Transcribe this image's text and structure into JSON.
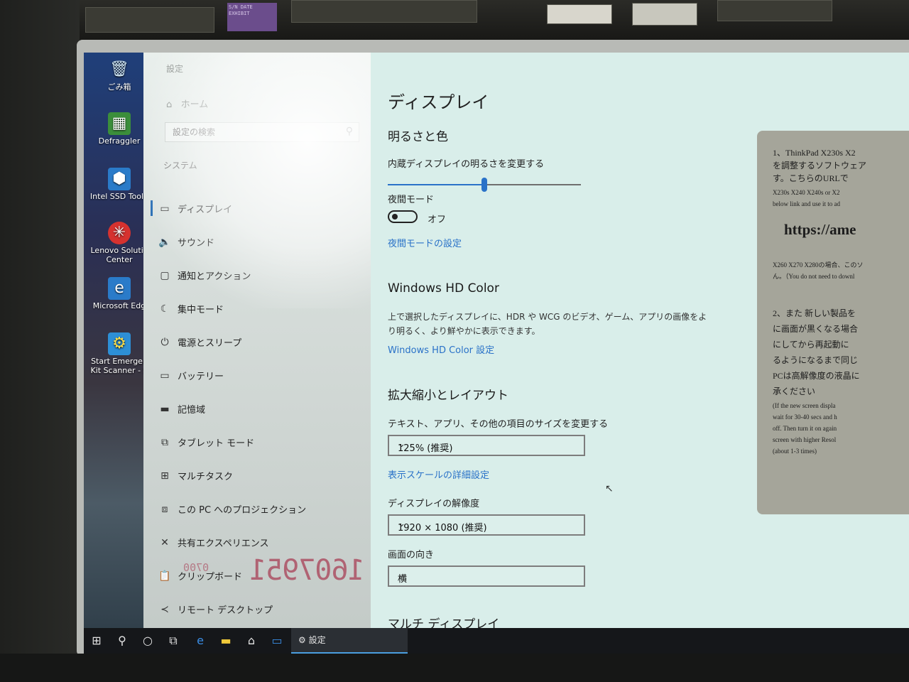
{
  "desktop": {
    "icons": [
      {
        "label": "ごみ箱",
        "icon": "recycle-bin-icon"
      },
      {
        "label": "Defraggler",
        "icon": "defraggler-icon"
      },
      {
        "label": "Intel SSD Toolb",
        "icon": "intel-ssd-icon"
      },
      {
        "label": "Lenovo Solutio",
        "label2": "Center",
        "icon": "lenovo-icon"
      },
      {
        "label": "Microsoft Edg",
        "icon": "edge-icon"
      },
      {
        "label": "Start Emergen",
        "label2": "Kit Scanner - S",
        "icon": "scanner-icon"
      }
    ]
  },
  "sidebar": {
    "app_title": "設定",
    "home": "ホーム",
    "search_placeholder": "設定の検索",
    "section": "システム",
    "items": [
      {
        "label": "ディスプレイ",
        "icon": "monitor-icon"
      },
      {
        "label": "サウンド",
        "icon": "speaker-icon"
      },
      {
        "label": "通知とアクション",
        "icon": "notification-icon"
      },
      {
        "label": "集中モード",
        "icon": "moon-icon"
      },
      {
        "label": "電源とスリープ",
        "icon": "power-icon"
      },
      {
        "label": "バッテリー",
        "icon": "battery-icon"
      },
      {
        "label": "記憶域",
        "icon": "storage-icon"
      },
      {
        "label": "タブレット モード",
        "icon": "tablet-icon"
      },
      {
        "label": "マルチタスク",
        "icon": "multitask-icon"
      },
      {
        "label": "この PC へのプロジェクション",
        "icon": "projection-icon"
      },
      {
        "label": "共有エクスペリエンス",
        "icon": "share-icon"
      },
      {
        "label": "クリップボード",
        "icon": "clipboard-icon"
      },
      {
        "label": "リモート デスクトップ",
        "icon": "remote-icon"
      }
    ]
  },
  "content": {
    "title": "ディスプレイ",
    "brightness": {
      "heading": "明るさと色",
      "label": "内蔵ディスプレイの明るさを変更する",
      "value_percent": 50
    },
    "night_mode": {
      "label": "夜間モード",
      "state": "オフ",
      "settings_link": "夜間モードの設定"
    },
    "hd_color": {
      "heading": "Windows HD Color",
      "description": "上で選択したディスプレイに、HDR や WCG のビデオ、ゲーム、アプリの画像をより明るく、より鮮やかに表示できます。",
      "link": "Windows HD Color 設定"
    },
    "scale_layout": {
      "heading": "拡大縮小とレイアウト",
      "scale_label": "テキスト、アプリ、その他の項目のサイズを変更する",
      "scale_value": "125% (推奨)",
      "advanced_link": "表示スケールの詳細設定",
      "resolution_label": "ディスプレイの解像度",
      "resolution_value": "1920 × 1080 (推奨)",
      "orientation_label": "画面の向き",
      "orientation_value": "横"
    },
    "multi_display_heading": "マルチ ディスプレイ"
  },
  "paper": {
    "lines": [
      "1、ThinkPad X230s X2",
      "を調整するソフトウェア",
      "す。こちらのURLで",
      "X230s X240 X240s or X2",
      "below link and use it to ad",
      "https://ame",
      "X260 X270 X280の場合、このソ",
      "ん。（You do not need to downl",
      "2、また 新しい製品を",
      "に画面が黒くなる場合",
      "にしてから再起動に",
      "るようになるまで同じ",
      "PCは高解像度の液晶に",
      "承ください",
      "(If the new screen displa",
      "wait for 30-40 secs and h",
      "off. Then turn it on again",
      "screen with higher Resol",
      "(about 1-3 times)"
    ]
  },
  "stamp": {
    "main": "1607951",
    "small": "0700"
  },
  "taskbar": {
    "icons": [
      "windows-start-icon",
      "search-icon",
      "cortana-icon",
      "task-view-icon",
      "edge-icon",
      "file-explorer-icon",
      "store-icon",
      "mail-icon"
    ],
    "active_app": "設定"
  },
  "hardware_label": "S/N DATE EXHIBIT"
}
